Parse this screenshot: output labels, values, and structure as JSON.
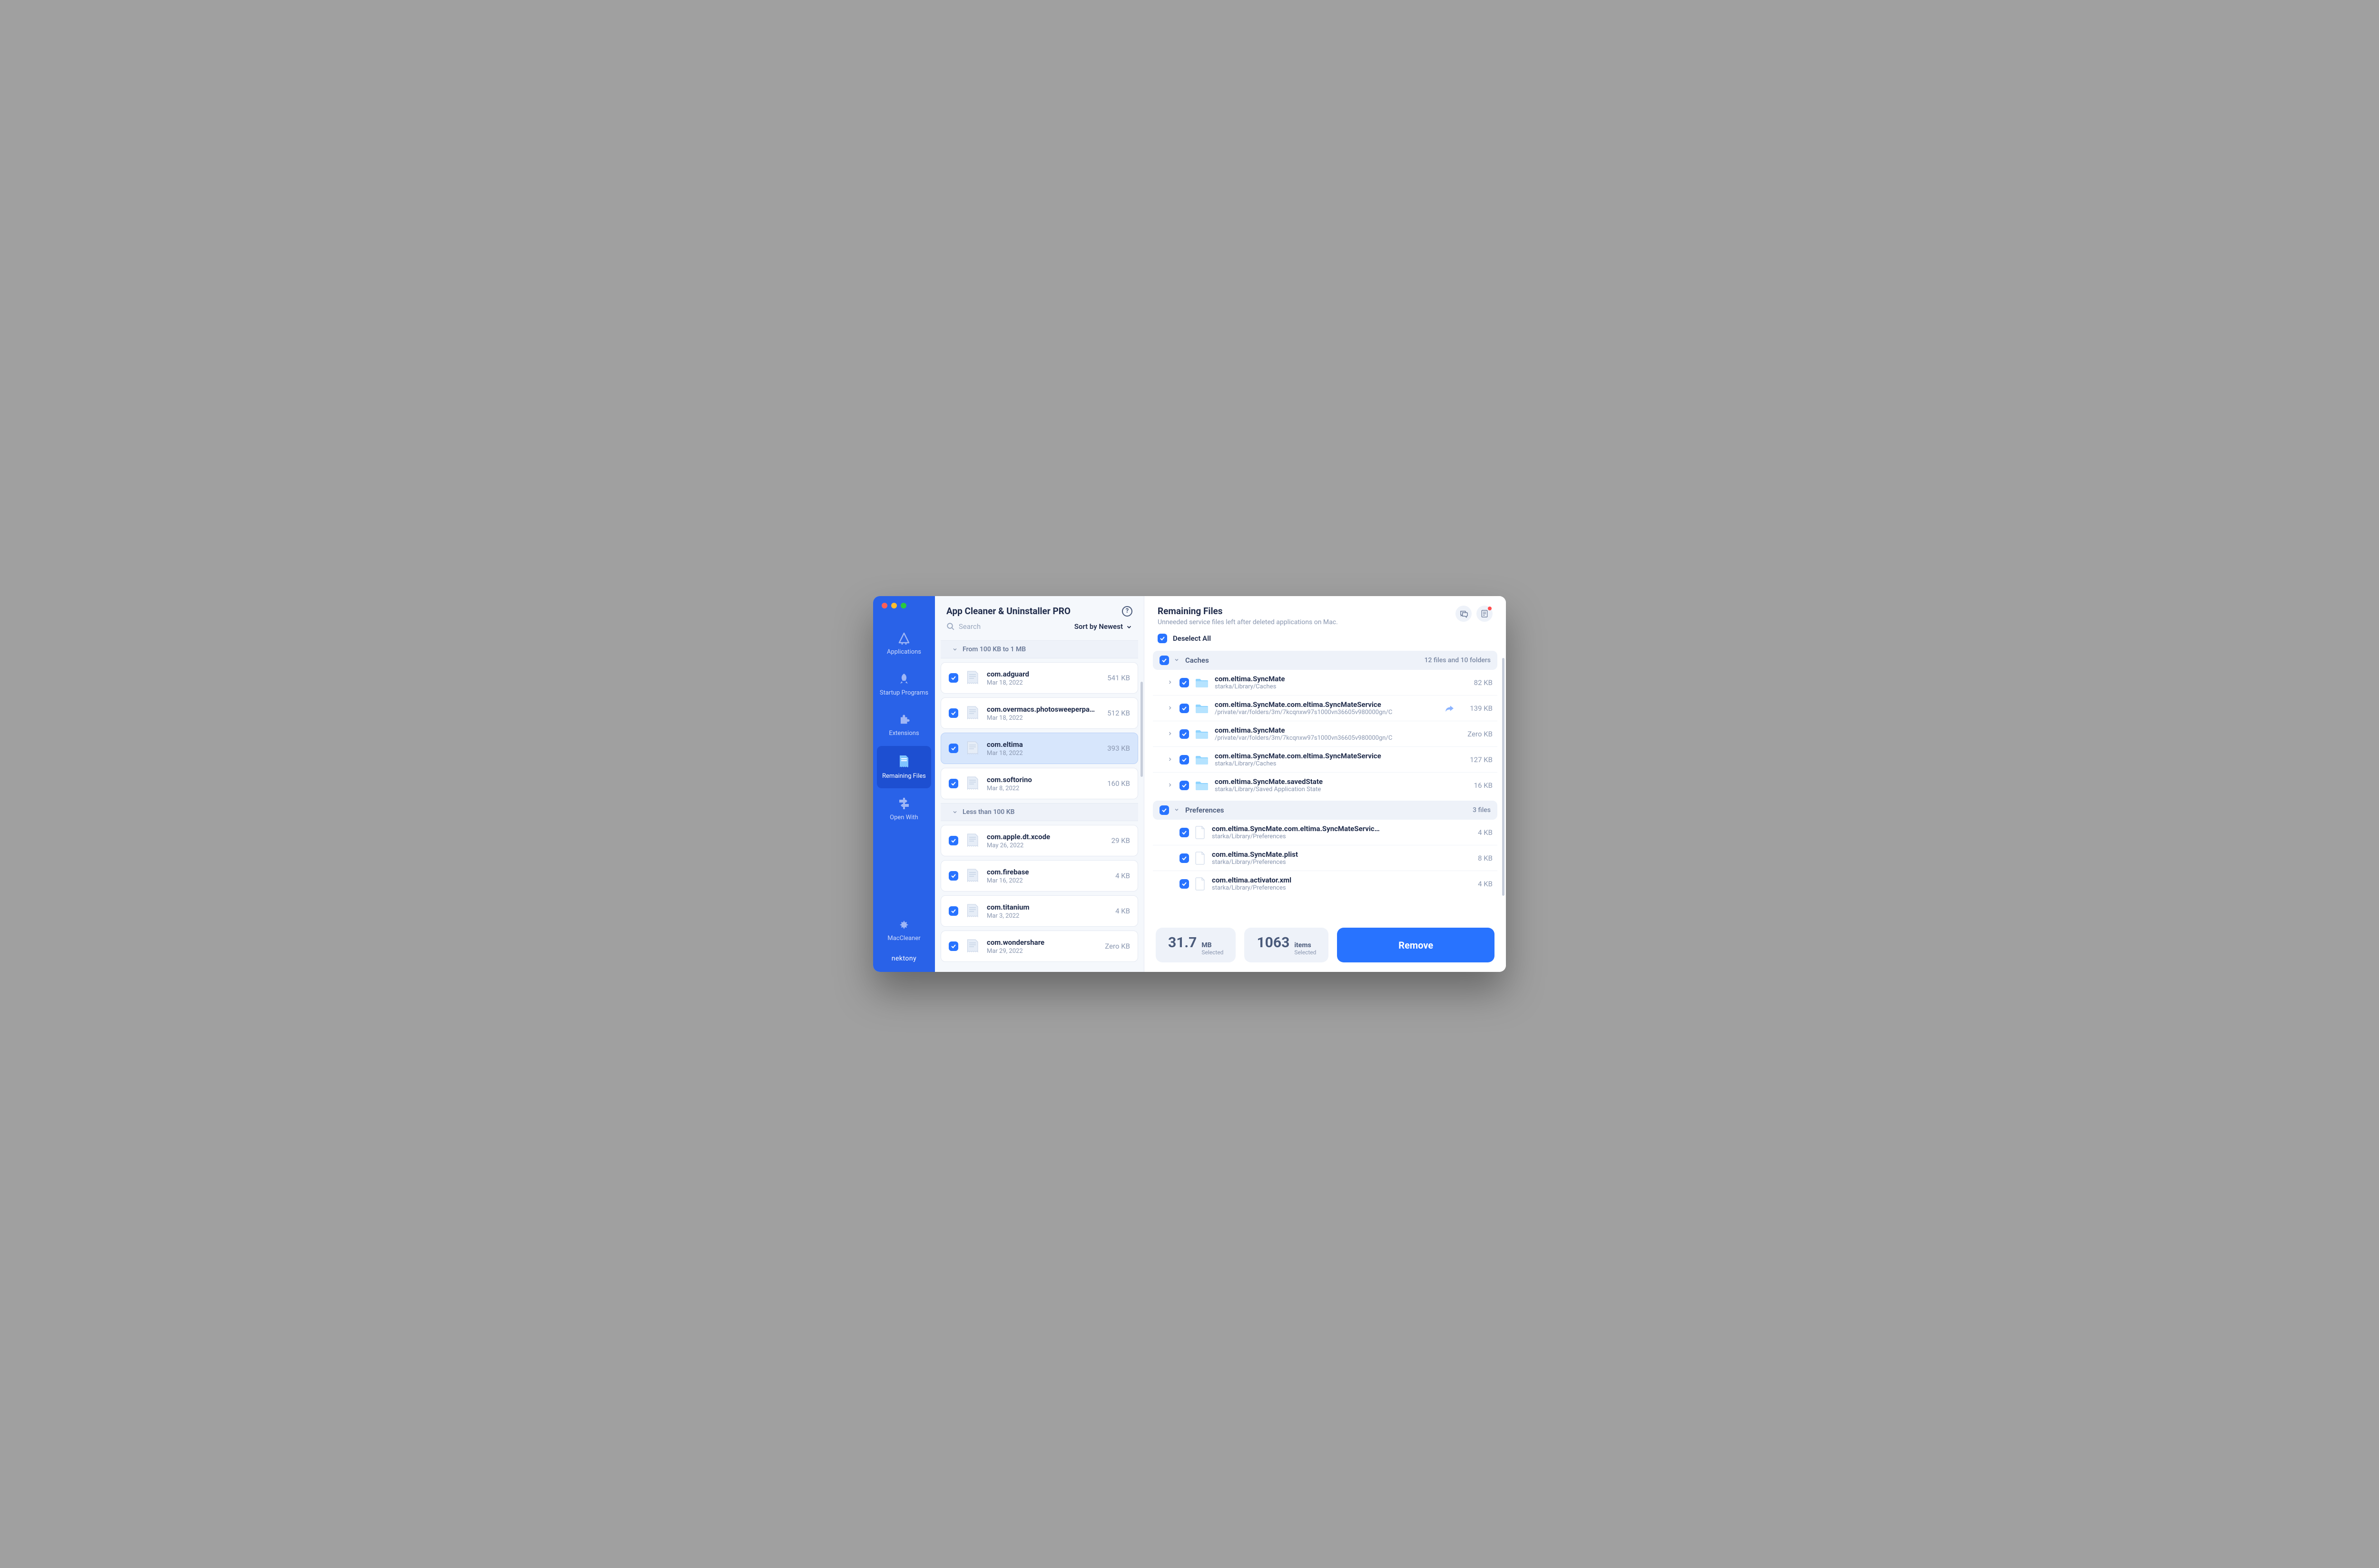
{
  "app_title": "App Cleaner & Uninstaller PRO",
  "search_placeholder": "Search",
  "sort_label": "Sort by Newest",
  "sidebar": {
    "items": [
      {
        "label": "Applications"
      },
      {
        "label": "Startup Programs"
      },
      {
        "label": "Extensions"
      },
      {
        "label": "Remaining Files"
      },
      {
        "label": "Open With"
      }
    ],
    "maccleaner": "MacCleaner",
    "brand": "nektony"
  },
  "sections": [
    {
      "header": "From 100 KB to 1 MB",
      "items": [
        {
          "name": "com.adguard",
          "date": "Mar 18, 2022",
          "size": "541 KB",
          "selected": false
        },
        {
          "name": "com.overmacs.photosweeperpa…",
          "date": "Mar 18, 2022",
          "size": "512 KB",
          "selected": false
        },
        {
          "name": "com.eltima",
          "date": "Mar 18, 2022",
          "size": "393 KB",
          "selected": true
        },
        {
          "name": "com.softorino",
          "date": "Mar 8, 2022",
          "size": "160 KB",
          "selected": false
        }
      ]
    },
    {
      "header": "Less than 100 KB",
      "items": [
        {
          "name": "com.apple.dt.xcode",
          "date": "May 26, 2022",
          "size": "29 KB",
          "selected": false
        },
        {
          "name": "com.firebase",
          "date": "Mar 16, 2022",
          "size": "4 KB",
          "selected": false
        },
        {
          "name": "com.titanium",
          "date": "Mar 3, 2022",
          "size": "4 KB",
          "selected": false
        },
        {
          "name": "com.wondershare",
          "date": "Mar 29, 2022",
          "size": "Zero KB",
          "selected": false
        }
      ]
    }
  ],
  "detail": {
    "title": "Remaining Files",
    "subtitle": "Unneeded service files left after deleted applications on Mac.",
    "deselect_label": "Deselect All",
    "groups": [
      {
        "name": "Caches",
        "meta": "12 files and 10 folders",
        "rows": [
          {
            "kind": "folder",
            "expandable": true,
            "name": "com.eltima.SyncMate",
            "path": "starka/Library/Caches",
            "size": "82 KB"
          },
          {
            "kind": "folder",
            "expandable": true,
            "share": true,
            "name": "com.eltima.SyncMate.com.eltima.SyncMateService",
            "path": "/private/var/folders/3m/7kcqnxw97s1000vn36605v980000gn/C",
            "size": "139 KB"
          },
          {
            "kind": "folder",
            "expandable": true,
            "name": "com.eltima.SyncMate",
            "path": "/private/var/folders/3m/7kcqnxw97s1000vn36605v980000gn/C",
            "size": "Zero KB"
          },
          {
            "kind": "folder",
            "expandable": true,
            "name": "com.eltima.SyncMate.com.eltima.SyncMateService",
            "path": "starka/Library/Caches",
            "size": "127 KB"
          },
          {
            "kind": "folder",
            "expandable": true,
            "name": "com.eltima.SyncMate.savedState",
            "path": "starka/Library/Saved Application State",
            "size": "16 KB"
          }
        ]
      },
      {
        "name": "Preferences",
        "meta": "3 files",
        "rows": [
          {
            "kind": "doc",
            "name": "com.eltima.SyncMate.com.eltima.SyncMateServic…",
            "path": "starka/Library/Preferences",
            "size": "4 KB"
          },
          {
            "kind": "doc",
            "name": "com.eltima.SyncMate.plist",
            "path": "starka/Library/Preferences",
            "size": "8 KB"
          },
          {
            "kind": "doc",
            "name": "com.eltima.activator.xml",
            "path": "starka/Library/Preferences",
            "size": "4 KB"
          }
        ]
      }
    ]
  },
  "footer": {
    "size_num": "31.7",
    "size_unit": "MB",
    "size_sel": "Selected",
    "count_num": "1063",
    "count_unit": "items",
    "count_sel": "Selected",
    "remove": "Remove"
  }
}
